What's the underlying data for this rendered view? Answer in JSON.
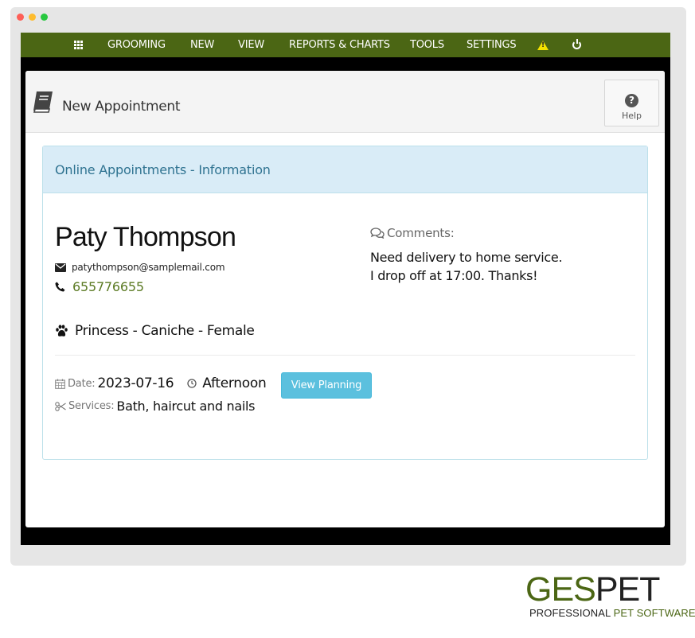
{
  "colors": {
    "navbar": "#4b6614",
    "accent_green": "#5b7a23",
    "panel_heading": "#d9ecf7",
    "heading_text": "#2f7391",
    "info_button": "#5bc0de",
    "warning": "#f3e100"
  },
  "navbar": {
    "items": [
      {
        "label": "GROOMING"
      },
      {
        "label": "NEW"
      },
      {
        "label": "VIEW"
      },
      {
        "label": "REPORTS & CHARTS"
      },
      {
        "label": "TOOLS"
      },
      {
        "label": "SETTINGS"
      }
    ],
    "icons": [
      "grid-icon",
      "warning-icon",
      "power-icon"
    ]
  },
  "page": {
    "title": "New Appointment",
    "help_label": "Help"
  },
  "appointment": {
    "heading": "Online Appointments - Information",
    "client_name": "Paty Thompson",
    "email": "patythompson@samplemail.com",
    "phone": "655776655",
    "pet": "Princess - Caniche - Female",
    "comments_label": "Comments:",
    "comments_line1": "Need delivery to home service.",
    "comments_line2": "I drop off at 17:00. Thanks!",
    "date_label": "Date:",
    "date": "2023-07-16",
    "shift": "Afternoon",
    "view_planning_label": "View Planning",
    "services_label": "Services:",
    "services": "Bath, haircut and nails"
  },
  "logo": {
    "name_part1": "GES",
    "name_part2": "PET",
    "tagline_part1": "PROFESSIONAL ",
    "tagline_part2": "PET SOFTWARE"
  }
}
